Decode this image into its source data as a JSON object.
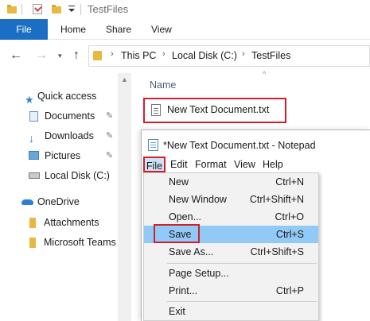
{
  "window": {
    "title": "TestFiles"
  },
  "ribbon": {
    "tabs": [
      "File",
      "Home",
      "Share",
      "View"
    ]
  },
  "address": {
    "crumbs": [
      "This PC",
      "Local Disk (C:)",
      "TestFiles"
    ]
  },
  "nav": {
    "items": [
      {
        "label": "Quick access",
        "icon": "star-icon"
      },
      {
        "label": "Documents",
        "icon": "documents-icon",
        "pinned": true
      },
      {
        "label": "Downloads",
        "icon": "downloads-icon",
        "pinned": true
      },
      {
        "label": "Pictures",
        "icon": "pictures-icon",
        "pinned": true
      },
      {
        "label": "Local Disk (C:)",
        "icon": "drive-icon"
      },
      {
        "label": "OneDrive",
        "icon": "cloud-icon"
      },
      {
        "label": "Attachments",
        "icon": "folder-icon"
      },
      {
        "label": "Microsoft Teams",
        "icon": "folder-icon"
      }
    ]
  },
  "filelist": {
    "column_name": "Name",
    "files": [
      {
        "name": "New Text Document.txt"
      }
    ]
  },
  "notepad": {
    "title": "*New Text Document.txt - Notepad",
    "menu": [
      "File",
      "Edit",
      "Format",
      "View",
      "Help"
    ],
    "file_menu": [
      {
        "label": "New",
        "shortcut": "Ctrl+N"
      },
      {
        "label": "New Window",
        "shortcut": "Ctrl+Shift+N"
      },
      {
        "label": "Open...",
        "shortcut": "Ctrl+O"
      },
      {
        "label": "Save",
        "shortcut": "Ctrl+S"
      },
      {
        "label": "Save As...",
        "shortcut": "Ctrl+Shift+S"
      },
      {
        "label": "Page Setup...",
        "shortcut": ""
      },
      {
        "label": "Print...",
        "shortcut": "Ctrl+P"
      },
      {
        "label": "Exit",
        "shortcut": ""
      }
    ]
  },
  "colors": {
    "accent": "#1a6fc4",
    "highlight_box": "#d41f2a",
    "menu_hover": "#91c9f7"
  }
}
